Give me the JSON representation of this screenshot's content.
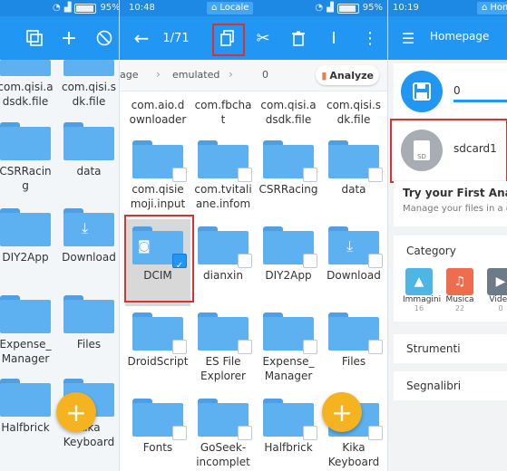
{
  "panel1": {
    "items": [
      {
        "label": "com.qisi.a\ndsdk.file"
      },
      {
        "label": "com.qisi.s\ndk.file"
      },
      {
        "label": "CSRRacin\ng"
      },
      {
        "label": "data"
      },
      {
        "label": "DIY2App"
      },
      {
        "label": "Download"
      },
      {
        "label": "Expense_\nManager"
      },
      {
        "label": "Files"
      },
      {
        "label": "Halfbrick"
      },
      {
        "label": "Kika\nKeyboard"
      }
    ],
    "fab": "+"
  },
  "panel2": {
    "status": {
      "time": "10:48",
      "battery": "95%"
    },
    "location_tab": "Locale",
    "toolbar": {
      "selection_count": "1/71"
    },
    "breadcrumb": {
      "item1": "age",
      "item2": "emulated",
      "item3": "0",
      "analyze_label": "Analyze"
    },
    "items": [
      {
        "label": "com.aio.d\nownloader"
      },
      {
        "label": "com.fbcha\nt"
      },
      {
        "label": "com.qisi.a\ndsdk.file"
      },
      {
        "label": "com.qisi.s\ndk.file"
      },
      {
        "label": "com.qisie\nmoji.input"
      },
      {
        "label": "com.tvitali\nane.infom"
      },
      {
        "label": "CSRRacing"
      },
      {
        "label": "data"
      },
      {
        "label": "DCIM"
      },
      {
        "label": "dianxin"
      },
      {
        "label": "DIY2App"
      },
      {
        "label": "Download"
      },
      {
        "label": "DroidScript"
      },
      {
        "label": "ES File\nExplorer"
      },
      {
        "label": "Expense_\nManager"
      },
      {
        "label": "Files"
      },
      {
        "label": "Fonts"
      },
      {
        "label": "GoSeek-\nincomplet"
      },
      {
        "label": "Halfbrick"
      },
      {
        "label": "Kika\nKeyboard"
      }
    ],
    "fab": "+"
  },
  "panel3": {
    "status": {
      "time": "10:19"
    },
    "location_tab": "Home",
    "toolbar": {
      "title": "Homepage"
    },
    "storage": [
      {
        "name": "0"
      },
      {
        "name": "sdcard1",
        "chip_label": "SD"
      }
    ],
    "analysis": {
      "title": "Try your First Analysis",
      "subtitle": "Manage your files in a diffe"
    },
    "category": {
      "title": "Category",
      "items": [
        {
          "label": "Immagini",
          "count": "16",
          "color": "#4db6e5"
        },
        {
          "label": "Musica",
          "count": "22",
          "color": "#f06c4f"
        },
        {
          "label": "Video",
          "count": "0",
          "color": "#6d7a88"
        }
      ]
    },
    "menu": [
      {
        "label": "Strumenti"
      },
      {
        "label": "Segnalibri"
      }
    ]
  },
  "colors": {
    "accent": "#2196f3",
    "highlight": "#d93232",
    "fab": "#f5b320"
  }
}
